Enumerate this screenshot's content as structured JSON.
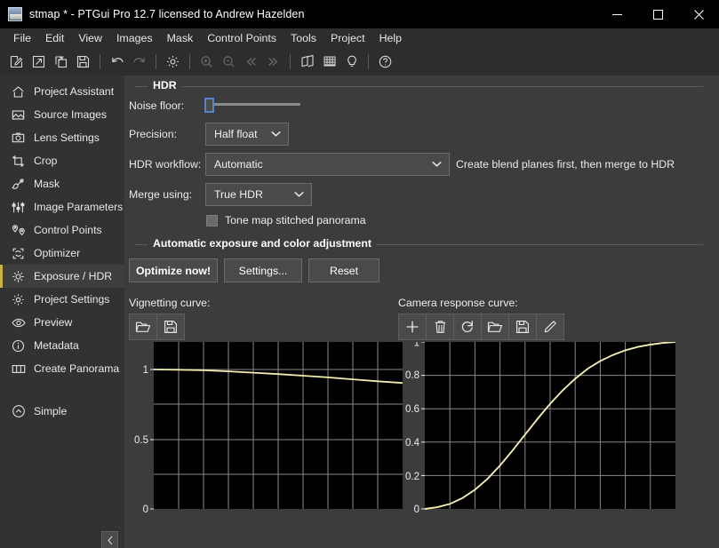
{
  "window": {
    "title": "stmap * - PTGui Pro 12.7 licensed to Andrew Hazelden",
    "app_icon": "image-file-icon",
    "minimize_label": "minimize-icon",
    "maximize_label": "maximize-icon",
    "close_label": "close-icon"
  },
  "menubar": {
    "items": [
      {
        "label": "File"
      },
      {
        "label": "Edit"
      },
      {
        "label": "View"
      },
      {
        "label": "Images"
      },
      {
        "label": "Mask"
      },
      {
        "label": "Control Points"
      },
      {
        "label": "Tools"
      },
      {
        "label": "Project"
      },
      {
        "label": "Help"
      }
    ]
  },
  "toolbar": {
    "buttons": [
      {
        "name": "new-project-icon",
        "enabled": true
      },
      {
        "name": "open-project-icon",
        "enabled": true
      },
      {
        "name": "duplicate-project-icon",
        "enabled": true
      },
      {
        "name": "save-project-icon",
        "enabled": true
      },
      {
        "name": "undo-icon",
        "enabled": true
      },
      {
        "name": "redo-icon",
        "enabled": false
      },
      {
        "name": "settings-gear-icon",
        "enabled": true
      },
      {
        "name": "zoom-in-icon",
        "enabled": false
      },
      {
        "name": "zoom-out-icon",
        "enabled": false
      },
      {
        "name": "previous-icon",
        "enabled": false
      },
      {
        "name": "next-icon",
        "enabled": false
      },
      {
        "name": "panorama-editor-icon",
        "enabled": true
      },
      {
        "name": "grid-icon",
        "enabled": true
      },
      {
        "name": "lightbulb-icon",
        "enabled": true
      },
      {
        "name": "help-icon",
        "enabled": true
      }
    ]
  },
  "sidebar": {
    "items": [
      {
        "label": "Project Assistant",
        "icon": "home-icon",
        "active": false
      },
      {
        "label": "Source Images",
        "icon": "picture-icon",
        "active": false
      },
      {
        "label": "Lens Settings",
        "icon": "camera-icon",
        "active": false
      },
      {
        "label": "Crop",
        "icon": "crop-icon",
        "active": false
      },
      {
        "label": "Mask",
        "icon": "brush-icon",
        "active": false
      },
      {
        "label": "Image Parameters",
        "icon": "sliders-icon",
        "active": false
      },
      {
        "label": "Control Points",
        "icon": "map-pins-icon",
        "active": false
      },
      {
        "label": "Optimizer",
        "icon": "refresh-frame-icon",
        "active": false
      },
      {
        "label": "Exposure / HDR",
        "icon": "sun-icon",
        "active": true
      },
      {
        "label": "Project Settings",
        "icon": "gear-icon",
        "active": false
      },
      {
        "label": "Preview",
        "icon": "eye-icon",
        "active": false
      },
      {
        "label": "Metadata",
        "icon": "info-icon",
        "active": false
      },
      {
        "label": "Create Panorama",
        "icon": "panorama-icon",
        "active": false
      }
    ],
    "mode_switch": {
      "label": "Simple",
      "icon": "chevron-up-circle-icon"
    },
    "collapse_button": {
      "icon": "chevron-left-icon"
    },
    "active_indicator_color": "#c8b441"
  },
  "hdr_group": {
    "title": "HDR",
    "noise_floor": {
      "label": "Noise floor:",
      "value": 0,
      "min": 0,
      "max": 100
    },
    "precision": {
      "label": "Precision:",
      "value": "Half float"
    },
    "hdr_workflow": {
      "label": "HDR workflow:",
      "value": "Automatic",
      "hint": "Create blend planes first, then merge to HDR"
    },
    "merge_using": {
      "label": "Merge using:",
      "value": "True HDR"
    },
    "tone_map": {
      "label": "Tone map stitched panorama",
      "checked": false
    }
  },
  "exposure_group": {
    "title": "Automatic exposure and color adjustment",
    "buttons": [
      {
        "label": "Optimize now!",
        "bold": true
      },
      {
        "label": "Settings...",
        "bold": false
      },
      {
        "label": "Reset",
        "bold": false
      }
    ]
  },
  "vignetting": {
    "label": "Vignetting curve:",
    "toolbar": [
      {
        "name": "open-folder-icon"
      },
      {
        "name": "save-floppy-icon"
      }
    ]
  },
  "camera_response": {
    "label": "Camera response curve:",
    "toolbar": [
      {
        "name": "add-plus-icon"
      },
      {
        "name": "delete-trash-icon"
      },
      {
        "name": "reset-refresh-icon"
      },
      {
        "name": "open-folder-icon"
      },
      {
        "name": "save-floppy-icon"
      },
      {
        "name": "edit-pencil-icon"
      }
    ]
  },
  "chart_data": [
    {
      "type": "line",
      "title": "Vignetting curve",
      "curve_color": "#f2edad",
      "background": "#000000",
      "grid": true,
      "grid_cols": 10,
      "grid_rows": 5,
      "xlabel": "",
      "ylabel": "",
      "xlim": [
        0,
        1
      ],
      "ylim": [
        0,
        1
      ],
      "ytick_labels": [
        "1",
        "0.5",
        "0"
      ],
      "ytick_values": [
        1,
        0.5,
        0
      ],
      "x": [
        0.0,
        0.1,
        0.2,
        0.3,
        0.4,
        0.5,
        0.6,
        0.7,
        0.8,
        0.9,
        1.0
      ],
      "values": [
        1.0,
        0.999,
        0.997,
        0.993,
        0.988,
        0.983,
        0.977,
        0.971,
        0.964,
        0.957,
        0.95
      ]
    },
    {
      "type": "line",
      "title": "Camera response curve",
      "curve_color": "#f2edad",
      "background": "#000000",
      "grid": true,
      "grid_cols": 10,
      "grid_rows": 5,
      "xlabel": "",
      "ylabel": "",
      "xlim": [
        0,
        1
      ],
      "ylim": [
        0,
        1
      ],
      "ytick_labels": [
        "1",
        "0.8",
        "0.6",
        "0.4",
        "0.2",
        "0"
      ],
      "ytick_values": [
        1,
        0.8,
        0.6,
        0.4,
        0.2,
        0
      ],
      "x": [
        0.0,
        0.05,
        0.1,
        0.15,
        0.2,
        0.25,
        0.3,
        0.35,
        0.4,
        0.45,
        0.5,
        0.55,
        0.6,
        0.65,
        0.7,
        0.75,
        0.8,
        0.85,
        0.9,
        0.95,
        1.0
      ],
      "values": [
        0.0,
        0.01,
        0.03,
        0.065,
        0.115,
        0.18,
        0.26,
        0.35,
        0.445,
        0.54,
        0.63,
        0.71,
        0.78,
        0.84,
        0.886,
        0.922,
        0.95,
        0.97,
        0.984,
        0.994,
        1.0
      ]
    }
  ]
}
